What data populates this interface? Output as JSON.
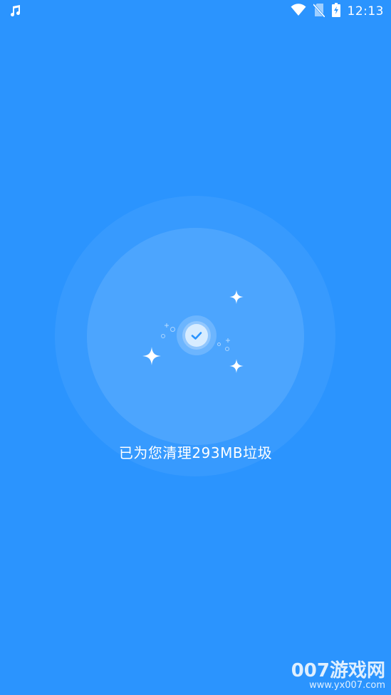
{
  "status_bar": {
    "time": "12:13",
    "icons": [
      "music-note-icon",
      "wifi-icon",
      "no-sim-icon",
      "battery-charging-icon"
    ]
  },
  "result": {
    "message": "已为您清理293MB垃圾"
  },
  "watermark": {
    "line1": "007游戏网",
    "line2": "www.yx007.com"
  },
  "colors": {
    "background": "#2b94fe",
    "check": "#2b94fe",
    "text": "#ffffff"
  }
}
